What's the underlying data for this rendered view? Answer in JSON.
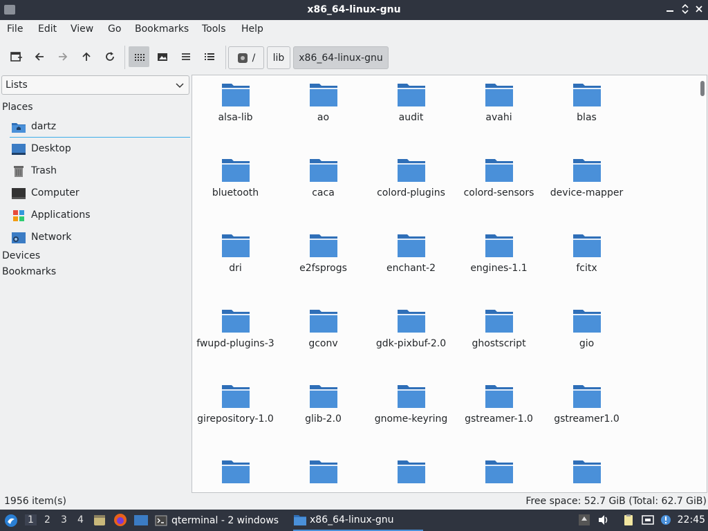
{
  "window": {
    "title": "x86_64-linux-gnu",
    "buttons": [
      "minimize",
      "maximize",
      "close"
    ]
  },
  "menu": [
    "File",
    "Edit",
    "View",
    "Go",
    "Bookmarks",
    "Tools",
    "Help"
  ],
  "toolbar": {
    "buttons": [
      "new-window-icon",
      "back-icon",
      "forward-icon",
      "up-icon",
      "reload-icon",
      "icon-view-icon",
      "thumbnail-view-icon",
      "compact-view-icon",
      "detailed-list-icon"
    ],
    "breadcrumb": {
      "root": "/",
      "items": [
        "lib",
        "x86_64-linux-gnu"
      ]
    }
  },
  "sidebar": {
    "mode": "Lists",
    "places_label": "Places",
    "places": [
      {
        "label": "dartz",
        "icon": "home-folder-icon"
      },
      {
        "label": "Desktop",
        "icon": "desktop-icon"
      },
      {
        "label": "Trash",
        "icon": "trash-icon"
      },
      {
        "label": "Computer",
        "icon": "computer-icon"
      },
      {
        "label": "Applications",
        "icon": "applications-icon"
      },
      {
        "label": "Network",
        "icon": "network-icon"
      }
    ],
    "devices_label": "Devices",
    "bookmarks_label": "Bookmarks"
  },
  "files": [
    "alsa-lib",
    "ao",
    "audit",
    "avahi",
    "blas",
    "bluetooth",
    "caca",
    "colord-plugins",
    "colord-sensors",
    "device-mapper",
    "dri",
    "e2fsprogs",
    "enchant-2",
    "engines-1.1",
    "fcitx",
    "fwupd-plugins-3",
    "gconv",
    "gdk-pixbuf-2.0",
    "ghostscript",
    "gio",
    "girepository-1.0",
    "glib-2.0",
    "gnome-keyring",
    "gstreamer-1.0",
    "gstreamer1.0",
    "",
    "",
    "",
    "",
    ""
  ],
  "status": {
    "items": "1956 item(s)",
    "free_space": "Free space: 52.7 GiB (Total: 62.7 GiB)"
  },
  "taskbar": {
    "workspaces": [
      "1",
      "2",
      "3",
      "4"
    ],
    "tasks": [
      "qterminal - 2 windows",
      "x86_64-linux-gnu"
    ],
    "clock": "22:45"
  },
  "colors": {
    "folder": "#4a90d9",
    "folder_dark": "#2f6fb8",
    "accent": "#3daee9",
    "titlebar": "#2f343f"
  }
}
